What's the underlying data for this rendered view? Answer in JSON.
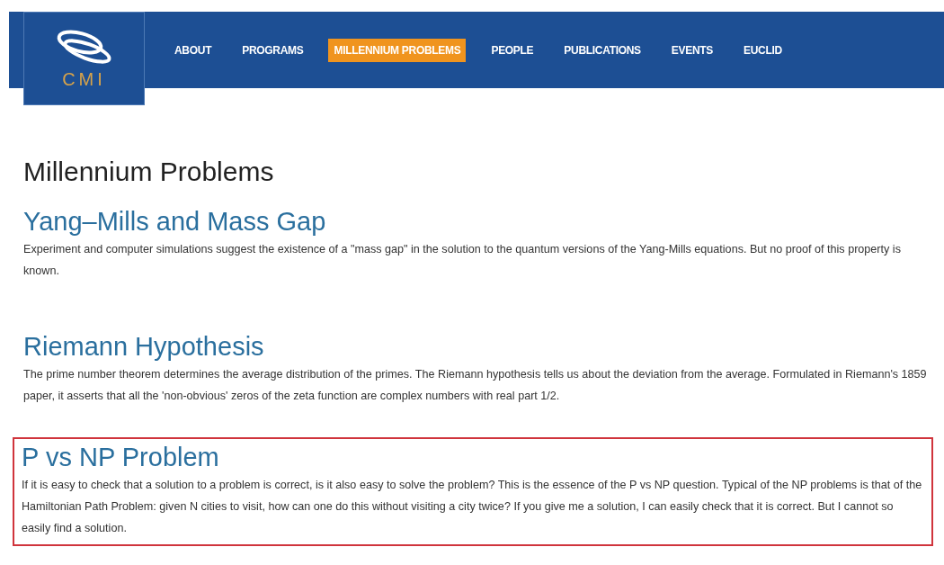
{
  "logo": {
    "text": "CMI"
  },
  "nav": [
    {
      "label": "ABOUT",
      "selected": false
    },
    {
      "label": "PROGRAMS",
      "selected": false
    },
    {
      "label": "MILLENNIUM PROBLEMS",
      "selected": true
    },
    {
      "label": "PEOPLE",
      "selected": false
    },
    {
      "label": "PUBLICATIONS",
      "selected": false
    },
    {
      "label": "EVENTS",
      "selected": false
    },
    {
      "label": "EUCLID",
      "selected": false
    }
  ],
  "page_title": "Millennium Problems",
  "problems": [
    {
      "title": "Yang–Mills and Mass Gap",
      "text": "Experiment and computer simulations suggest the existence of a \"mass gap\" in the solution to the quantum versions of the Yang-Mills equations. But no proof of this property is known.",
      "highlighted": false
    },
    {
      "title": "Riemann Hypothesis",
      "text": "The prime number theorem determines the average distribution of the primes. The Riemann hypothesis tells us about the deviation from the average. Formulated in Riemann's 1859 paper, it asserts that all the 'non-obvious' zeros of the zeta function are complex numbers with real part 1/2.",
      "highlighted": false
    },
    {
      "title": "P vs NP Problem",
      "text": "If it is easy to check that a solution to a problem is correct, is it also easy to solve the problem? This is the essence of the P vs NP question. Typical of the NP problems is that of the Hamiltonian Path Problem: given N cities to visit, how can one do this without visiting a city twice? If you give me a solution, I can easily check that it is correct. But I cannot so easily find a solution.",
      "highlighted": true
    }
  ]
}
